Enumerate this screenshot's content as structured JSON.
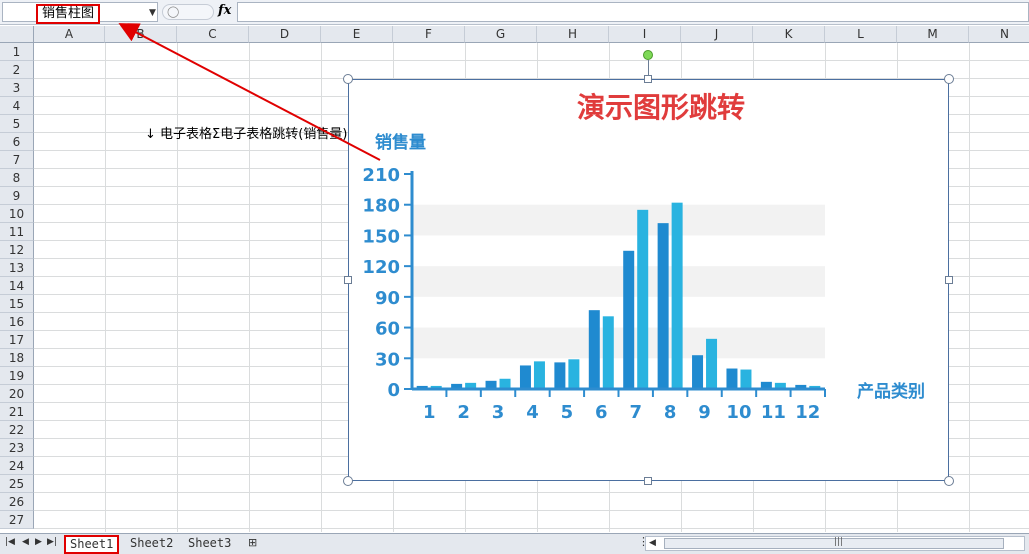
{
  "formula_bar": {
    "name_box": "销售柱图",
    "fx_label": "fx",
    "formula_value": ""
  },
  "grid": {
    "columns": [
      "A",
      "B",
      "C",
      "D",
      "E",
      "F",
      "G",
      "H",
      "I",
      "J",
      "K",
      "L",
      "M",
      "N"
    ],
    "rows": [
      "1",
      "2",
      "3",
      "4",
      "5",
      "6",
      "7",
      "8",
      "9",
      "10",
      "11",
      "12",
      "13",
      "14",
      "15",
      "16",
      "17",
      "18",
      "19",
      "20",
      "21",
      "22",
      "23",
      "24",
      "25",
      "26",
      "27"
    ],
    "b3_text": "电子表格Σ电子表格跳转(销售量)",
    "b3_icon": "hyperlink-arrow-icon"
  },
  "chart_data": {
    "type": "bar",
    "title": "演示图形跳转",
    "ylabel": "销售量",
    "xlabel": "产品类别",
    "categories": [
      "1",
      "2",
      "3",
      "4",
      "5",
      "6",
      "7",
      "8",
      "9",
      "10",
      "11",
      "12"
    ],
    "series": [
      {
        "values": [
          3,
          5,
          8,
          23,
          26,
          77,
          135,
          162,
          33,
          20,
          7,
          4
        ],
        "color": "#1f8ad0"
      },
      {
        "values": [
          3,
          6,
          10,
          27,
          29,
          71,
          175,
          182,
          49,
          19,
          6,
          3
        ],
        "color": "#29b3e0"
      }
    ],
    "ylim": [
      0,
      210
    ],
    "yticks": [
      "0",
      "30",
      "60",
      "90",
      "120",
      "150",
      "180",
      "210"
    ],
    "title_color": "#e03c3c",
    "axis_color": "#2e8ccf",
    "band_color": "#f2f2f2"
  },
  "sheet_tabs": {
    "tabs": [
      "Sheet1",
      "Sheet2",
      "Sheet3"
    ],
    "active": "Sheet1",
    "new_sheet_icon": "insert-sheet-icon"
  },
  "annotation": {
    "color": "#e00000"
  }
}
